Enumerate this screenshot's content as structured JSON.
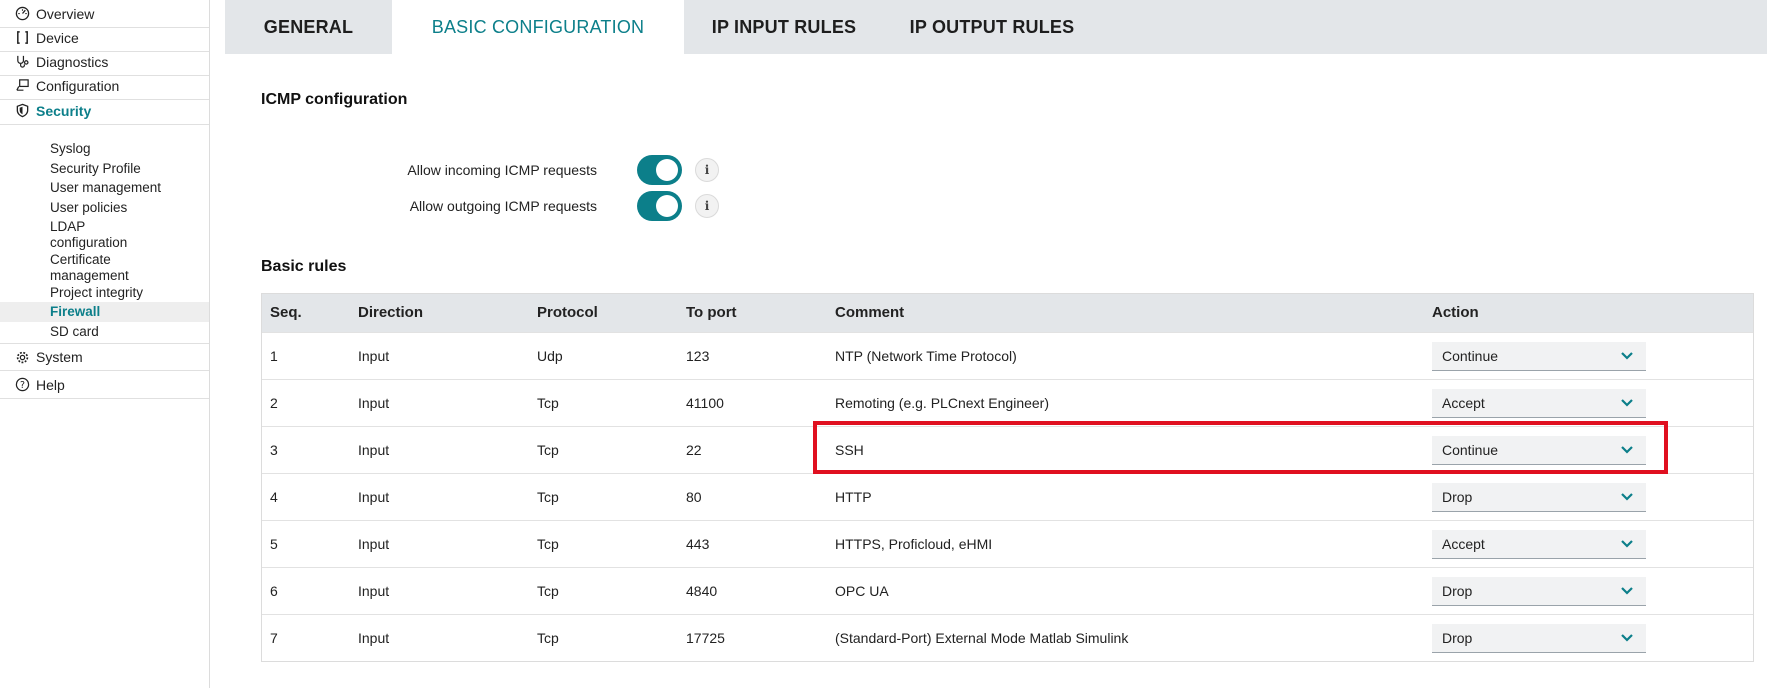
{
  "sidebar": {
    "items": [
      {
        "label": "Overview",
        "icon": "dashboard-icon"
      },
      {
        "label": "Device",
        "icon": "device-icon"
      },
      {
        "label": "Diagnostics",
        "icon": "stethoscope-icon"
      },
      {
        "label": "Configuration",
        "icon": "configuration-icon"
      },
      {
        "label": "Security",
        "icon": "shield-icon"
      },
      {
        "label": "System",
        "icon": "gear-icon"
      },
      {
        "label": "Help",
        "icon": "help-icon"
      }
    ],
    "security_sub": [
      "Syslog",
      "Security Profile",
      "User management",
      "User policies",
      "LDAP configuration",
      "Certificate management",
      "Project integrity",
      "Firewall",
      "SD card"
    ]
  },
  "tabs": [
    "GENERAL",
    "BASIC CONFIGURATION",
    "IP INPUT RULES",
    "IP OUTPUT RULES"
  ],
  "icmp": {
    "title": "ICMP configuration",
    "incoming_label": "Allow incoming ICMP requests",
    "outgoing_label": "Allow outgoing ICMP requests",
    "incoming_enabled": true,
    "outgoing_enabled": true,
    "info_glyph": "i"
  },
  "basic_rules": {
    "title": "Basic rules",
    "headers": [
      "Seq.",
      "Direction",
      "Protocol",
      "To port",
      "Comment",
      "Action"
    ],
    "rows": [
      {
        "seq": "1",
        "direction": "Input",
        "protocol": "Udp",
        "port": "123",
        "comment": "NTP (Network Time Protocol)",
        "action": "Continue"
      },
      {
        "seq": "2",
        "direction": "Input",
        "protocol": "Tcp",
        "port": "41100",
        "comment": "Remoting (e.g. PLCnext Engineer)",
        "action": "Accept"
      },
      {
        "seq": "3",
        "direction": "Input",
        "protocol": "Tcp",
        "port": "22",
        "comment": "SSH",
        "action": "Continue"
      },
      {
        "seq": "4",
        "direction": "Input",
        "protocol": "Tcp",
        "port": "80",
        "comment": "HTTP",
        "action": "Drop"
      },
      {
        "seq": "5",
        "direction": "Input",
        "protocol": "Tcp",
        "port": "443",
        "comment": "HTTPS, Proficloud, eHMI",
        "action": "Accept"
      },
      {
        "seq": "6",
        "direction": "Input",
        "protocol": "Tcp",
        "port": "4840",
        "comment": "OPC UA",
        "action": "Drop"
      },
      {
        "seq": "7",
        "direction": "Input",
        "protocol": "Tcp",
        "port": "17725",
        "comment": "(Standard-Port) External Mode Matlab Simulink",
        "action": "Drop"
      }
    ]
  },
  "colors": {
    "accent": "#0c7f8a",
    "highlight": "#e01020",
    "tabbar": "#e3e6e9"
  }
}
